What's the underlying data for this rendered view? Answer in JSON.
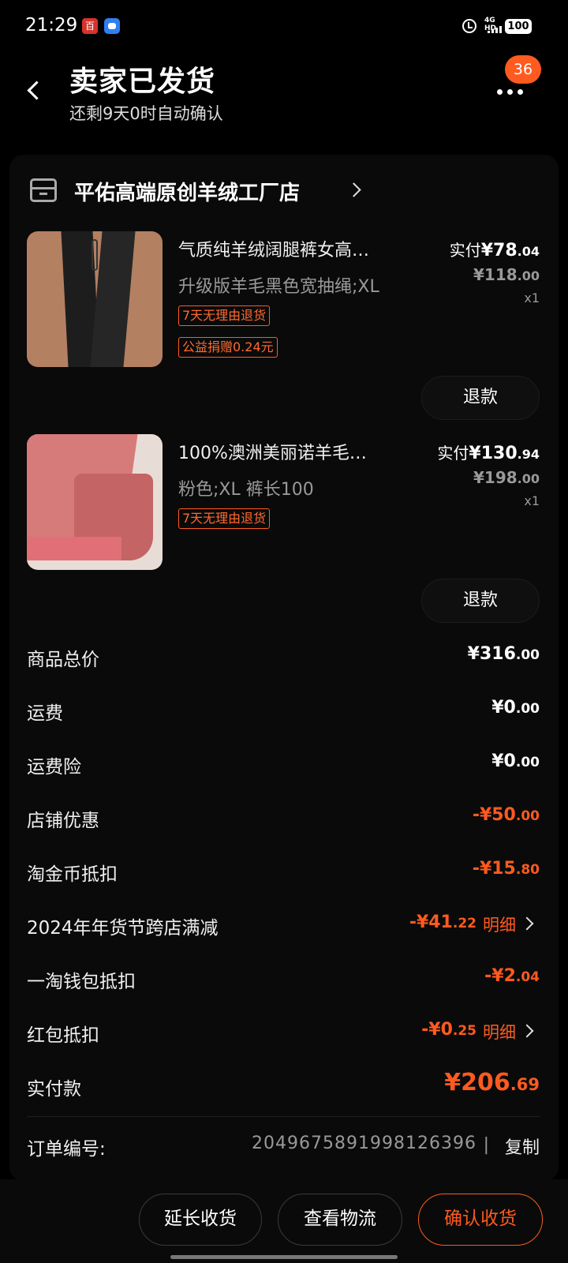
{
  "status_bar": {
    "time": "21:29",
    "app1": "百",
    "network": "4G HD",
    "battery": "100"
  },
  "header": {
    "title": "卖家已发货",
    "subtitle": "还剩9天0时自动确认",
    "badge_count": "36"
  },
  "shop": {
    "name": "平佑高端原创羊绒工厂店"
  },
  "items": [
    {
      "title": "气质纯羊绒阔腿裤女高…",
      "spec": "升级版羊毛黑色宽抽绳;XL",
      "tags": [
        "7天无理由退货",
        "公益捐赠0.24元"
      ],
      "paid_label": "实付",
      "paid_currency": "¥",
      "paid_int": "78",
      "paid_dec": ".04",
      "orig_int": "¥118",
      "orig_dec": ".00",
      "qty": "x1",
      "refund_label": "退款"
    },
    {
      "title": "100%澳洲美丽诺羊毛…",
      "spec": "粉色;XL  裤长100",
      "tags": [
        "7天无理由退货"
      ],
      "paid_label": "实付",
      "paid_currency": "¥",
      "paid_int": "130",
      "paid_dec": ".94",
      "orig_int": "¥198",
      "orig_dec": ".00",
      "qty": "x1",
      "refund_label": "退款"
    }
  ],
  "fees": [
    {
      "label": "商品总价",
      "int": "¥316",
      "dec": ".00"
    },
    {
      "label": "运费",
      "int": "¥0",
      "dec": ".00"
    },
    {
      "label": "运费险",
      "int": "¥0",
      "dec": ".00"
    },
    {
      "label": "店铺优惠",
      "int": "-¥50",
      "dec": ".00"
    },
    {
      "label": "淘金币抵扣",
      "int": "-¥15",
      "dec": ".80"
    },
    {
      "label": "2024年年货节跨店满减",
      "int": "-¥41",
      "dec": ".22",
      "detail": "明细"
    },
    {
      "label": "一淘钱包抵扣",
      "int": "-¥2",
      "dec": ".04"
    },
    {
      "label": "红包抵扣",
      "int": "-¥0",
      "dec": ".25",
      "detail": "明细"
    }
  ],
  "total": {
    "label": "实付款",
    "int": "¥206",
    "dec": ".69"
  },
  "order": {
    "label": "订单编号:",
    "number": "2049675891998126396",
    "separator": "|",
    "copy": "复制"
  },
  "bottom_bar": {
    "extend": "延长收货",
    "logistics": "查看物流",
    "confirm": "确认收货"
  },
  "colors": {
    "accent": "#ff5a1f",
    "background": "#000000",
    "card": "#0a0a0a"
  }
}
